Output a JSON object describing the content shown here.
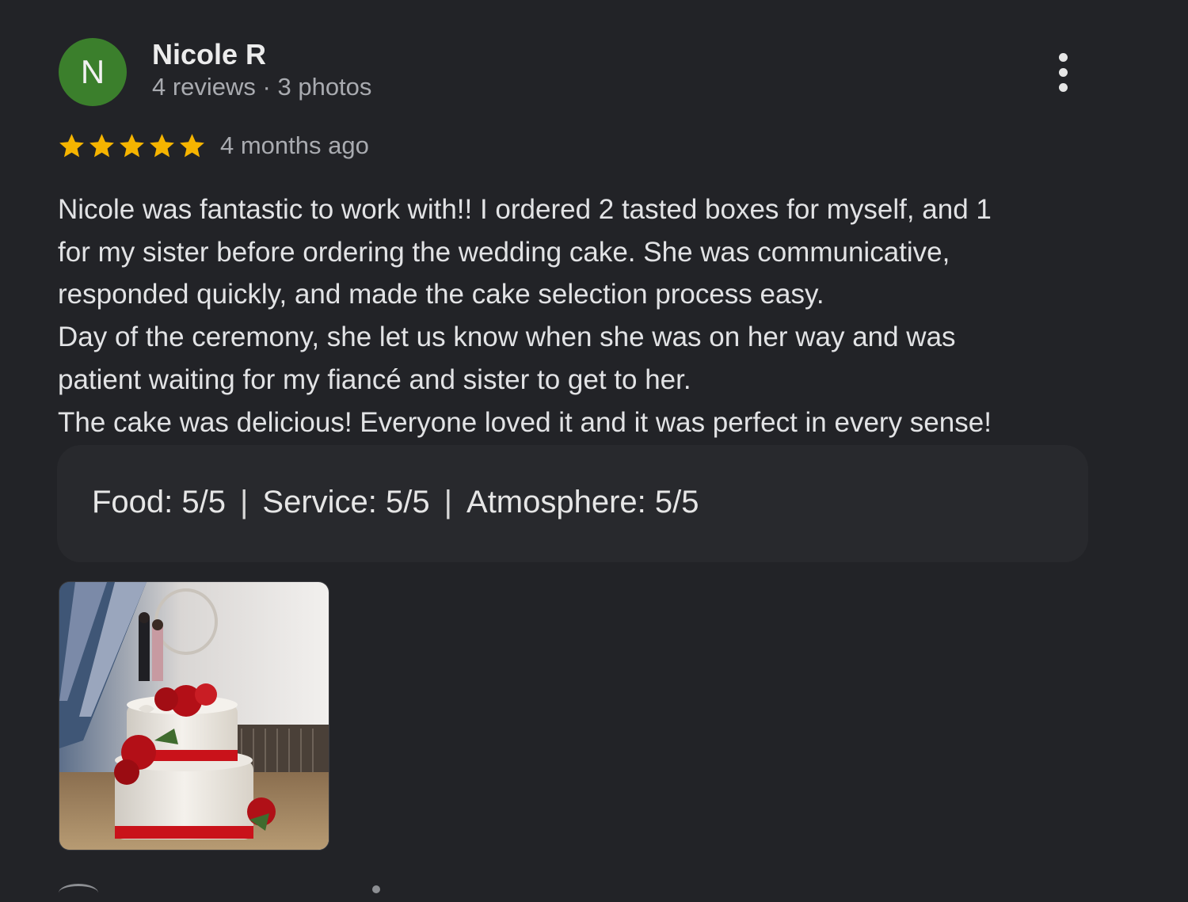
{
  "author": {
    "initial": "N",
    "name": "Nicole R",
    "meta": "4 reviews · 3 photos",
    "avatar_color": "#3b7f2c"
  },
  "menu_icon": "more-vert-icon",
  "rating": {
    "stars": 5,
    "max_stars": 5,
    "star_color": "#f5b400",
    "icon": "star-icon"
  },
  "time_ago": "4 months ago",
  "review_lines": [
    "Nicole was fantastic to work with!! I ordered 2 tasted boxes for myself, and 1",
    "for my sister before ordering the wedding cake. She was communicative,",
    "responded quickly, and made the cake selection process easy.",
    "Day of the ceremony, she let us know when she was on her way and was",
    "patient waiting for my fiancé and sister to get to her.",
    "The cake was delicious! Everyone loved it and it was perfect in every sense!"
  ],
  "ratings": {
    "food": "Food: 5/5",
    "separator": "|",
    "service": "Service: 5/5",
    "atmosphere": "Atmosphere: 5/5"
  },
  "photo": {
    "subject": "wedding-cake-photo"
  }
}
